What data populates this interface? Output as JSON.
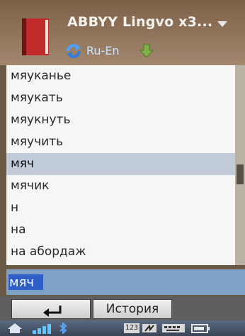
{
  "header": {
    "title": "ABBYY Lingvo x3...",
    "language_pair": "Ru-En",
    "icons": [
      "book-app-icon",
      "refresh-icon",
      "down-arrow-icon",
      "menu-dropdown-icon"
    ]
  },
  "word_list": {
    "items": [
      "мяуканье",
      "мяукать",
      "мяукнуть",
      "мяучить",
      "мяч",
      "мячик",
      "н",
      "на",
      "на абордаж"
    ],
    "selected": "мяч"
  },
  "search": {
    "value": "мяч"
  },
  "softkeys": {
    "left_icon": "back-arrow-icon",
    "right_label": "История"
  },
  "statusbar": {
    "input_mode": "123",
    "icons": [
      "home-icon",
      "signal-icon",
      "bluetooth-icon",
      "input-mode-icon",
      "keyboard-icon",
      "battery-icon"
    ]
  },
  "colors": {
    "selected_row": "#c2ccd8",
    "input_bg": "#7da1c7",
    "text_selection": "#2e5ec6",
    "header_bg": "#8e7159"
  }
}
